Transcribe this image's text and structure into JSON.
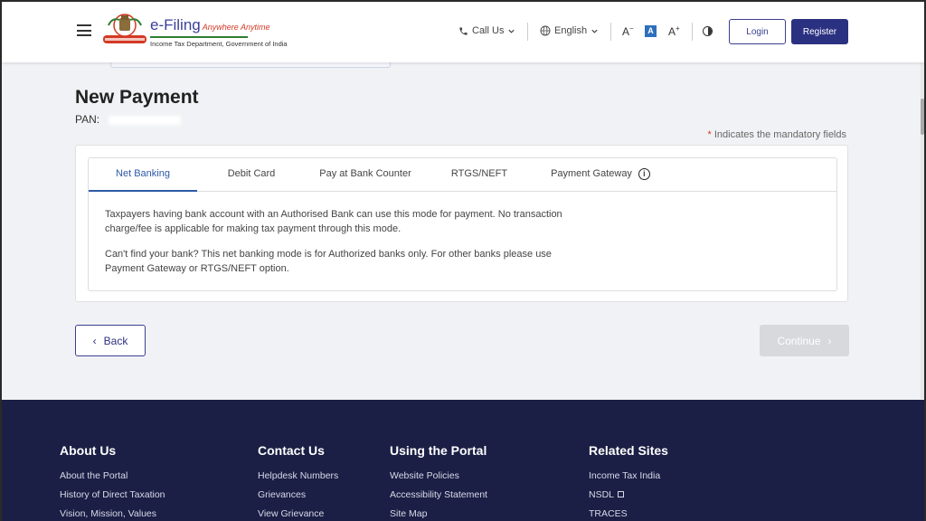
{
  "header": {
    "logo_title": "e-Filing",
    "logo_tagline": "Anywhere Anytime",
    "logo_subtitle": "Income Tax Department, Government of India",
    "call_us": "Call Us",
    "language": "English",
    "font_decrease": "A",
    "font_normal": "A",
    "font_increase": "A",
    "login": "Login",
    "register": "Register"
  },
  "page": {
    "title": "New Payment",
    "pan_label": "PAN:",
    "mandatory_star": "*",
    "mandatory_text": "Indicates the mandatory fields"
  },
  "tabs": [
    {
      "label": "Net Banking",
      "active": true
    },
    {
      "label": "Debit Card"
    },
    {
      "label": "Pay at Bank Counter"
    },
    {
      "label": "RTGS/NEFT"
    },
    {
      "label": "Payment Gateway"
    }
  ],
  "tab_content": {
    "para1": "Taxpayers having bank account with an Authorised Bank can use this mode for payment. No transaction charge/fee is applicable for making tax payment through this mode.",
    "para2": "Can't find your bank? This net banking mode is for Authorized banks only. For other banks please use Payment Gateway or RTGS/NEFT option."
  },
  "actions": {
    "back": "Back",
    "continue": "Continue"
  },
  "footer": {
    "columns": [
      {
        "heading": "About Us",
        "links": [
          "About the Portal",
          "History of Direct Taxation",
          "Vision, Mission, Values"
        ]
      },
      {
        "heading": "Contact Us",
        "links": [
          "Helpdesk Numbers",
          "Grievances",
          "View Grievance"
        ]
      },
      {
        "heading": "Using the Portal",
        "links": [
          "Website Policies",
          "Accessibility Statement",
          "Site Map"
        ]
      },
      {
        "heading": "Related Sites",
        "links": [
          "Income Tax India",
          "NSDL",
          "TRACES"
        ]
      }
    ]
  },
  "colors": {
    "brand_navy": "#2b3181",
    "tab_active": "#2e5aa8",
    "footer_bg": "#1b1f45"
  }
}
